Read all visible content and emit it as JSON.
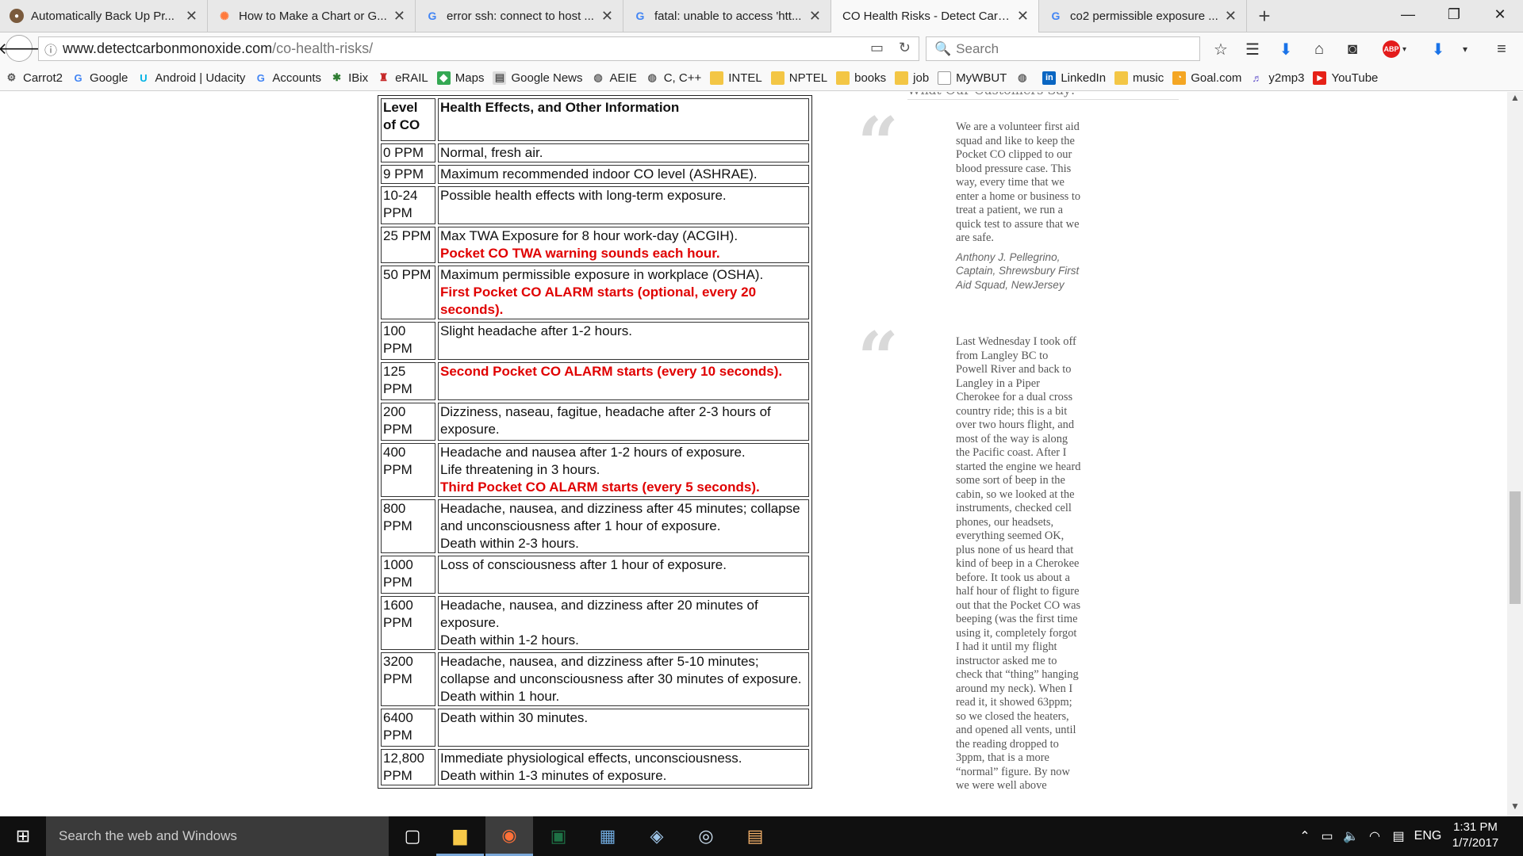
{
  "browser": {
    "tabs": [
      {
        "title": "Automatically Back Up Pr...",
        "icon": "avatar-icon"
      },
      {
        "title": "How to Make a Chart or G...",
        "icon": "hubspot-icon"
      },
      {
        "title": "error ssh: connect to host ...",
        "icon": "google-icon"
      },
      {
        "title": "fatal: unable to access 'htt...",
        "icon": "google-icon"
      },
      {
        "title": "CO Health Risks - Detect Carb...",
        "icon": "page-icon"
      },
      {
        "title": "co2 permissible exposure ...",
        "icon": "google-icon"
      }
    ],
    "url_host": "www.detectcarbonmonoxide.com",
    "url_path": "/co-health-risks/",
    "search_placeholder": "Search",
    "abp_label": "ABP",
    "bookmarks": [
      {
        "label": "Carrot2",
        "icon": "gear-icon"
      },
      {
        "label": "Google",
        "icon": "google-icon"
      },
      {
        "label": "Android | Udacity",
        "icon": "udacity-icon"
      },
      {
        "label": "Accounts",
        "icon": "google-icon"
      },
      {
        "label": "IBix",
        "icon": "plant-icon"
      },
      {
        "label": "eRAIL",
        "icon": "train-icon"
      },
      {
        "label": "Maps",
        "icon": "maps-icon"
      },
      {
        "label": "Google News",
        "icon": "news-icon"
      },
      {
        "label": "AEIE",
        "icon": "globe-icon"
      },
      {
        "label": "C, C++",
        "icon": "globe-icon"
      },
      {
        "label": "INTEL",
        "icon": "folder-icon"
      },
      {
        "label": "NPTEL",
        "icon": "folder-icon"
      },
      {
        "label": "books",
        "icon": "folder-icon"
      },
      {
        "label": "job",
        "icon": "folder-icon"
      },
      {
        "label": "MyWBUT",
        "icon": "page-icon"
      },
      {
        "label": "",
        "icon": "globe-icon"
      },
      {
        "label": "LinkedIn",
        "icon": "linkedin-icon"
      },
      {
        "label": "music",
        "icon": "folder-icon"
      },
      {
        "label": "Goal.com",
        "icon": "rss-icon"
      },
      {
        "label": "y2mp3",
        "icon": "y2mp3-icon"
      },
      {
        "label": "YouTube",
        "icon": "youtube-icon"
      }
    ]
  },
  "table": {
    "headers": [
      "Level of CO",
      "Health Effects, and Other Information"
    ],
    "rows": [
      {
        "level": "0 PPM",
        "lines": [
          "Normal, fresh air."
        ],
        "alarm": ""
      },
      {
        "level": "9 PPM",
        "lines": [
          "Maximum recommended indoor CO level (ASHRAE)."
        ],
        "alarm": ""
      },
      {
        "level": "10-24 PPM",
        "lines": [
          "Possible health effects with long-term exposure."
        ],
        "alarm": ""
      },
      {
        "level": "25 PPM",
        "lines": [
          "Max TWA Exposure for 8 hour work-day (ACGIH)."
        ],
        "alarm": "Pocket CO TWA warning sounds each hour."
      },
      {
        "level": "50 PPM",
        "lines": [
          "Maximum permissible exposure in workplace (OSHA)."
        ],
        "alarm": "First Pocket CO ALARM starts (optional, every 20 seconds)."
      },
      {
        "level": "100 PPM",
        "lines": [
          "Slight headache after 1-2 hours."
        ],
        "alarm": ""
      },
      {
        "level": "125 PPM",
        "lines": [],
        "alarm": "Second Pocket CO ALARM starts (every 10 seconds)."
      },
      {
        "level": "200 PPM",
        "lines": [
          "Dizziness, naseau, fagitue, headache after 2-3 hours of exposure."
        ],
        "alarm": ""
      },
      {
        "level": "400 PPM",
        "lines": [
          "Headache and nausea after 1-2 hours of exposure.",
          "Life threatening in 3 hours."
        ],
        "alarm": "Third Pocket CO ALARM starts (every 5 seconds)."
      },
      {
        "level": "800 PPM",
        "lines": [
          "Headache, nausea, and dizziness after 45 minutes; collapse and unconsciousness after 1 hour of exposure.",
          "Death within 2-3 hours."
        ],
        "alarm": ""
      },
      {
        "level": "1000 PPM",
        "lines": [
          "Loss of consciousness after 1 hour of exposure."
        ],
        "alarm": ""
      },
      {
        "level": "1600 PPM",
        "lines": [
          "Headache, nausea, and dizziness after 20 minutes of exposure.",
          "Death within 1-2 hours."
        ],
        "alarm": ""
      },
      {
        "level": "3200 PPM",
        "lines": [
          "Headache, nausea, and dizziness after 5-10 minutes; collapse and unconsciousness after 30 minutes of exposure.",
          "Death within 1 hour."
        ],
        "alarm": ""
      },
      {
        "level": "6400 PPM",
        "lines": [
          "Death within 30 minutes."
        ],
        "alarm": ""
      },
      {
        "level": "12,800 PPM",
        "lines": [
          "Immediate physiological effects, unconsciousness.",
          "Death within 1-3 minutes of exposure."
        ],
        "alarm": ""
      }
    ]
  },
  "sidebar": {
    "heading": "What Our Customers Say:",
    "quotes": [
      {
        "text": "We are a volunteer first aid squad and like to keep the Pocket CO clipped to our blood pressure case. This way, every time that we enter a home or business to treat a patient, we run a quick test to assure that we are safe.",
        "author": "Anthony J. Pellegrino, Captain, Shrewsbury First Aid Squad, NewJersey"
      },
      {
        "text": "Last Wednesday I took off from Langley BC to Powell River and back to Langley in a Piper Cherokee for a dual cross country ride; this is a bit over two hours flight, and most of the way is along the Pacific coast. After I started the engine we heard some sort of beep in the cabin, so we looked at the instruments, checked cell phones, our headsets, everything seemed OK, plus none of us heard that kind of beep in a Cherokee before. It took us about a half hour of flight to figure out that the Pocket CO was beeping (was the first time using it, completely forgot I had it until my flight instructor asked me to check that “thing” hanging around my neck). When I read it, it showed 63ppm; so we closed the heaters, and opened all vents, until the reading dropped to 3ppm, that is a more “normal” figure. By now we were well above",
        "author": ""
      }
    ]
  },
  "taskbar": {
    "search_placeholder": "Search the web and Windows",
    "language": "ENG",
    "time": "1:31 PM",
    "date": "1/7/2017",
    "apps": [
      "task-view-icon",
      "file-explorer-icon",
      "firefox-icon",
      "excel-icon",
      "network-icon",
      "app-icon",
      "wifi-app-icon",
      "remote-icon"
    ]
  },
  "colors": {
    "alarm_red": "#e00000",
    "tab_active": "#f9f9f9",
    "taskbar": "#101010"
  }
}
